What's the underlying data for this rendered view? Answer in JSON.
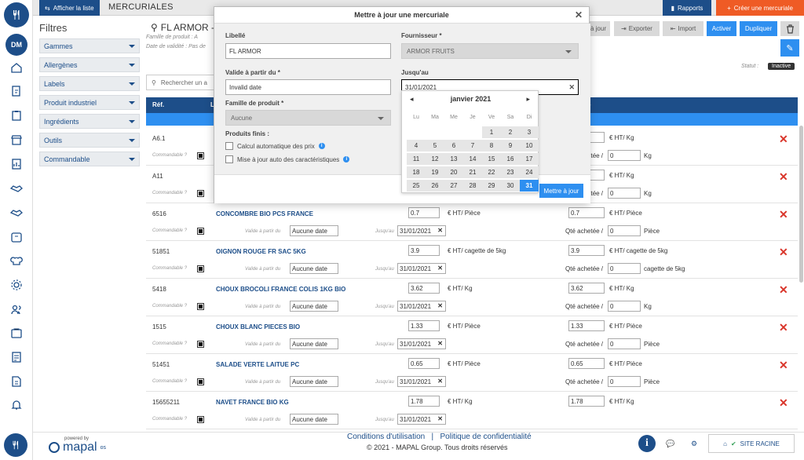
{
  "topbar": {
    "show_list_label": "Afficher la liste",
    "page_title": "MERCURIALES",
    "reports_label": "Rapports",
    "create_label": "Créer une mercuriale"
  },
  "rail": {
    "user_initials": "DM"
  },
  "filters": {
    "title": "Filtres",
    "items": [
      "Gammes",
      "Allergènes",
      "Labels",
      "Produit industriel",
      "Ingrédients",
      "Outils",
      "Commandable"
    ]
  },
  "main": {
    "supplier_title": "FL ARMOR - A",
    "family_info": "Famille de produit : A",
    "validity_info": "Date de validité : Pas de",
    "toolbar": {
      "import_fragment": "à jour",
      "export_label": "Exporter",
      "import_label": "Import",
      "activate_label": "Activer",
      "duplicate_label": "Dupliquer"
    },
    "status_label": "Statut :",
    "status_value": "Inactive",
    "search_placeholder": "Rechercher un a",
    "columns": {
      "ref": "Réf.",
      "libelle_short": "L",
      "price_short": "é"
    },
    "rows": [
      {
        "ref": "A6.1",
        "name": "",
        "price": "",
        "unit": "",
        "price2": "",
        "unit2": "€ HT/ Kg",
        "qty": "0",
        "qty_unit": "Kg",
        "valid_from": "",
        "until": ""
      },
      {
        "ref": "A11",
        "name": "",
        "price": "",
        "unit": "",
        "price2": "",
        "unit2": "€ HT/ Kg",
        "qty": "0",
        "qty_unit": "Kg",
        "valid_from": "",
        "until": ""
      },
      {
        "ref": "6516",
        "name": "CONCOMBRE BIO PCS FRANCE",
        "price": "0.7",
        "unit": "€ HT/ Pièce",
        "price2": "0.7",
        "unit2": "€ HT/ Pièce",
        "qty": "0",
        "qty_unit": "Pièce",
        "valid_from": "Aucune date",
        "until": "31/01/2021"
      },
      {
        "ref": "51851",
        "name": "OIGNON ROUGE FR SAC 5KG",
        "price": "3.9",
        "unit": "€ HT/ cagette de 5kg",
        "price2": "3.9",
        "unit2": "€ HT/ cagette de 5kg",
        "qty": "0",
        "qty_unit": "cagette de 5kg",
        "valid_from": "Aucune date",
        "until": "31/01/2021"
      },
      {
        "ref": "5418",
        "name": "CHOUX BROCOLI FRANCE COLIS 1KG BIO",
        "price": "3.62",
        "unit": "€ HT/ Kg",
        "price2": "3.62",
        "unit2": "€ HT/ Kg",
        "qty": "0",
        "qty_unit": "Kg",
        "valid_from": "Aucune date",
        "until": "31/01/2021"
      },
      {
        "ref": "1515",
        "name": "CHOUX BLANC PIECES BIO",
        "price": "1.33",
        "unit": "€ HT/ Pièce",
        "price2": "1.33",
        "unit2": "€ HT/ Pièce",
        "qty": "0",
        "qty_unit": "Pièce",
        "valid_from": "Aucune date",
        "until": "31/01/2021"
      },
      {
        "ref": "51451",
        "name": "SALADE VERTE LAITUE PC",
        "price": "0.65",
        "unit": "€ HT/ Pièce",
        "price2": "0.65",
        "unit2": "€ HT/ Pièce",
        "qty": "0",
        "qty_unit": "Pièce",
        "valid_from": "Aucune date",
        "until": "31/01/2021"
      },
      {
        "ref": "15655211",
        "name": "NAVET FRANCE BIO KG",
        "price": "1.78",
        "unit": "€ HT/ Kg",
        "price2": "1.78",
        "unit2": "€ HT/ Kg",
        "qty": "",
        "qty_unit": "",
        "valid_from": "Aucune date",
        "until": "31/01/2021"
      }
    ],
    "row_labels": {
      "orderable": "Commandable ?",
      "valid_from": "Valide à partir du",
      "until": "Jusqu'au",
      "qty_bought": "Qté achetée /"
    }
  },
  "modal": {
    "title": "Mettre à jour une mercuriale",
    "libelle_label": "Libellé",
    "libelle_value": "FL ARMOR",
    "supplier_label": "Fournisseur *",
    "supplier_value": "ARMOR FRUITS",
    "valid_from_label": "Valide à partir du *",
    "valid_from_value": "Invalid date",
    "until_label": "Jusqu'au",
    "until_value": "31/01/2021",
    "family_label": "Famille de produit *",
    "family_value": "Aucune",
    "finished_products_label": "Produits finis :",
    "auto_price_label": "Calcul automatique des prix",
    "auto_update_label": "Mise à jour auto des caractéristiques",
    "submit_label": "Mettre à jour"
  },
  "datepicker": {
    "month_label": "janvier 2021",
    "weekdays": [
      "Lu",
      "Ma",
      "Me",
      "Je",
      "Ve",
      "Sa",
      "Di"
    ],
    "weeks": [
      [
        "",
        "",
        "",
        "",
        "1",
        "2",
        "3"
      ],
      [
        "4",
        "5",
        "6",
        "7",
        "8",
        "9",
        "10"
      ],
      [
        "11",
        "12",
        "13",
        "14",
        "15",
        "16",
        "17"
      ],
      [
        "18",
        "19",
        "20",
        "21",
        "22",
        "23",
        "24"
      ],
      [
        "25",
        "26",
        "27",
        "28",
        "29",
        "30",
        "31"
      ]
    ],
    "selected": "31"
  },
  "footer": {
    "powered_by": "powered by",
    "brand": "mapal",
    "brand_suffix": "os",
    "terms": "Conditions d'utilisation",
    "separator": "|",
    "privacy": "Politique de confidentialité",
    "copyright": "© 2021 - MAPAL Group. Tous droits réservés",
    "site_label": "SITE RACINE"
  },
  "colors": {
    "brand_blue": "#1d4e89",
    "accent_blue": "#2e8ff0",
    "orange": "#ef5b25",
    "delete_red": "#d9352a"
  },
  "icons": {
    "rail": [
      "home-icon",
      "document-edit-icon",
      "clipboard-icon",
      "store-icon",
      "report-icon",
      "handshake-icon",
      "handshake-alt-icon",
      "box-icon",
      "chef-hat-icon",
      "settings-icon",
      "users-icon",
      "cart-icon",
      "invoice-icon",
      "file-icon",
      "bell-icon"
    ]
  }
}
